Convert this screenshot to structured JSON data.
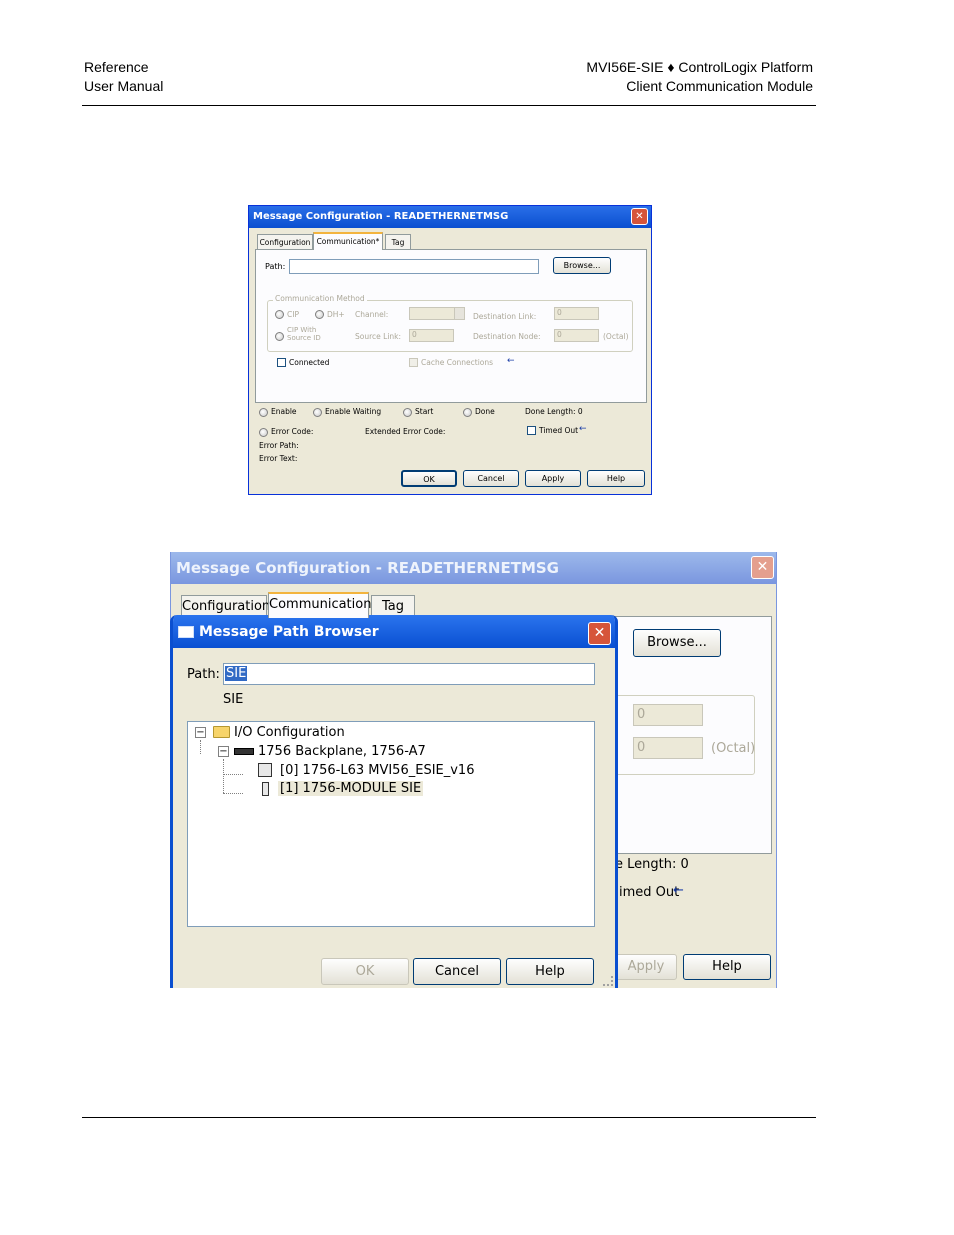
{
  "header": {
    "left_line1": "Reference",
    "left_line2": "User Manual",
    "right_line1": "MVI56E-SIE ♦ ControlLogix Platform",
    "right_line2": "Client Communication Module"
  },
  "dialog1": {
    "title": "Message Configuration - READETHERNETMSG",
    "close": "✕",
    "tabs": [
      "Configuration",
      "Communication*",
      "Tag"
    ],
    "path_label": "Path:",
    "path_value": "",
    "browse": "Browse...",
    "group_title": "Communication Method",
    "cip": "CIP",
    "dh": "DH+",
    "channel_label": "Channel:",
    "dest_link_label": "Destination Link:",
    "dest_link_value": "0",
    "cip_source_id": "CIP With Source ID",
    "source_link_label": "Source Link:",
    "source_link_value": "0",
    "dest_node_label": "Destination Node:",
    "dest_node_value": "0",
    "octal": "(Octal)",
    "connected": "Connected",
    "cache": "Cache Connections",
    "arrow": "←",
    "enable": "Enable",
    "enable_waiting": "Enable Waiting",
    "start": "Start",
    "done": "Done",
    "done_length": "Done Length:  0",
    "error_code": "Error Code:",
    "extended_error": "Extended Error Code:",
    "timed_out": "Timed Out",
    "error_path": "Error Path:",
    "error_text": "Error Text:",
    "ok": "OK",
    "cancel": "Cancel",
    "apply": "Apply",
    "help": "Help"
  },
  "dialog2": {
    "title": "Message Configuration - READETHERNETMSG",
    "close": "✕",
    "tabs": [
      "Configuration",
      "Communication",
      "Tag"
    ],
    "browse": "Browse...",
    "field_value_1": "0",
    "field_value_2": "0",
    "octal": "(Octal)",
    "length_fragment": "e Length:  0",
    "timed_out_fragment": "imed Out",
    "arrow": "←",
    "apply": "Apply",
    "help": "Help"
  },
  "path_browser": {
    "title": "Message Path Browser",
    "close": "✕",
    "path_label": "Path:",
    "path_value": "SIE",
    "path_resolved": "SIE",
    "tree": [
      {
        "expander": "−",
        "label": "I/O Configuration"
      },
      {
        "expander": "−",
        "label": "1756 Backplane, 1756-A7"
      },
      {
        "expander": "",
        "label": "[0] 1756-L63 MVI56_ESIE_v16"
      },
      {
        "expander": "",
        "label": "[1] 1756-MODULE SIE"
      }
    ],
    "ok": "OK",
    "cancel": "Cancel",
    "help": "Help"
  },
  "colors": {
    "titlebar_active": "#0a56d6",
    "titlebar_inactive": "#7a96df",
    "dialog_face": "#ece9d8"
  }
}
